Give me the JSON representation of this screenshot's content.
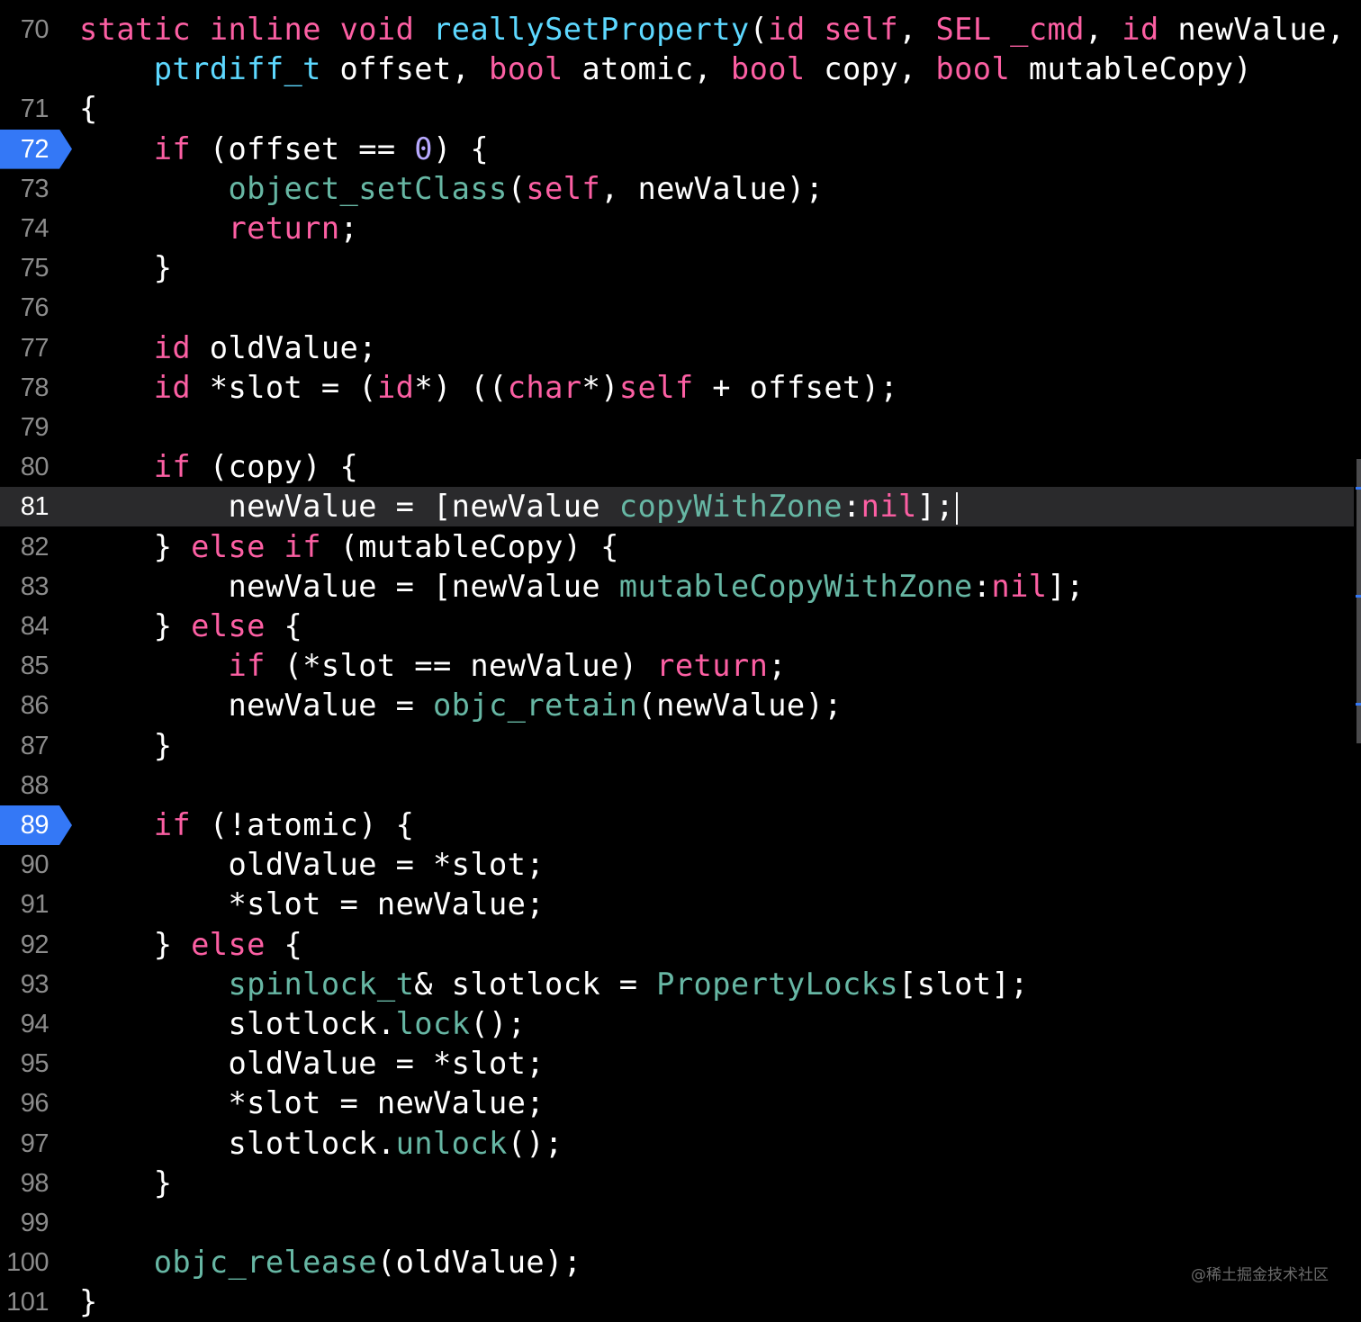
{
  "editor": {
    "cursor_line": "81",
    "breakpoint_lines": [
      "72",
      "89"
    ],
    "lines": [
      {
        "num": "70",
        "tokens": [
          {
            "t": "static",
            "c": "kw"
          },
          {
            "t": " ",
            "c": "plain"
          },
          {
            "t": "inline",
            "c": "kw"
          },
          {
            "t": " ",
            "c": "plain"
          },
          {
            "t": "void",
            "c": "kw"
          },
          {
            "t": " ",
            "c": "plain"
          },
          {
            "t": "reallySetProperty",
            "c": "sys"
          },
          {
            "t": "(",
            "c": "plain"
          },
          {
            "t": "id",
            "c": "kw"
          },
          {
            "t": " ",
            "c": "plain"
          },
          {
            "t": "self",
            "c": "kw"
          },
          {
            "t": ", ",
            "c": "plain"
          },
          {
            "t": "SEL",
            "c": "kw"
          },
          {
            "t": " ",
            "c": "plain"
          },
          {
            "t": "_cmd",
            "c": "kw"
          },
          {
            "t": ", ",
            "c": "plain"
          },
          {
            "t": "id",
            "c": "kw"
          },
          {
            "t": " newValue,",
            "c": "plain"
          }
        ]
      },
      {
        "num": "",
        "tokens": [
          {
            "t": "    ",
            "c": "plain"
          },
          {
            "t": "ptrdiff_t",
            "c": "sys"
          },
          {
            "t": " offset, ",
            "c": "plain"
          },
          {
            "t": "bool",
            "c": "kw"
          },
          {
            "t": " atomic, ",
            "c": "plain"
          },
          {
            "t": "bool",
            "c": "kw"
          },
          {
            "t": " copy, ",
            "c": "plain"
          },
          {
            "t": "bool",
            "c": "kw"
          },
          {
            "t": " mutableCopy)",
            "c": "plain"
          }
        ]
      },
      {
        "num": "71",
        "tokens": [
          {
            "t": "{",
            "c": "plain"
          }
        ]
      },
      {
        "num": "72",
        "tokens": [
          {
            "t": "    ",
            "c": "plain"
          },
          {
            "t": "if",
            "c": "kw"
          },
          {
            "t": " (offset == ",
            "c": "plain"
          },
          {
            "t": "0",
            "c": "num"
          },
          {
            "t": ") {",
            "c": "plain"
          }
        ]
      },
      {
        "num": "73",
        "tokens": [
          {
            "t": "        ",
            "c": "plain"
          },
          {
            "t": "object_setClass",
            "c": "fn"
          },
          {
            "t": "(",
            "c": "plain"
          },
          {
            "t": "self",
            "c": "kw"
          },
          {
            "t": ", newValue);",
            "c": "plain"
          }
        ]
      },
      {
        "num": "74",
        "tokens": [
          {
            "t": "        ",
            "c": "plain"
          },
          {
            "t": "return",
            "c": "kw"
          },
          {
            "t": ";",
            "c": "plain"
          }
        ]
      },
      {
        "num": "75",
        "tokens": [
          {
            "t": "    }",
            "c": "plain"
          }
        ]
      },
      {
        "num": "76",
        "tokens": []
      },
      {
        "num": "77",
        "tokens": [
          {
            "t": "    ",
            "c": "plain"
          },
          {
            "t": "id",
            "c": "kw"
          },
          {
            "t": " oldValue;",
            "c": "plain"
          }
        ]
      },
      {
        "num": "78",
        "tokens": [
          {
            "t": "    ",
            "c": "plain"
          },
          {
            "t": "id",
            "c": "kw"
          },
          {
            "t": " *slot = (",
            "c": "plain"
          },
          {
            "t": "id",
            "c": "kw"
          },
          {
            "t": "*) ((",
            "c": "plain"
          },
          {
            "t": "char",
            "c": "kw"
          },
          {
            "t": "*)",
            "c": "plain"
          },
          {
            "t": "self",
            "c": "kw"
          },
          {
            "t": " + offset);",
            "c": "plain"
          }
        ]
      },
      {
        "num": "79",
        "tokens": []
      },
      {
        "num": "80",
        "tokens": [
          {
            "t": "    ",
            "c": "plain"
          },
          {
            "t": "if",
            "c": "kw"
          },
          {
            "t": " (copy) {",
            "c": "plain"
          }
        ]
      },
      {
        "num": "81",
        "tokens": [
          {
            "t": "        newValue = [newValue ",
            "c": "plain"
          },
          {
            "t": "copyWithZone",
            "c": "fn"
          },
          {
            "t": ":",
            "c": "plain"
          },
          {
            "t": "nil",
            "c": "kw"
          },
          {
            "t": "];",
            "c": "plain"
          }
        ]
      },
      {
        "num": "82",
        "tokens": [
          {
            "t": "    } ",
            "c": "plain"
          },
          {
            "t": "else",
            "c": "kw"
          },
          {
            "t": " ",
            "c": "plain"
          },
          {
            "t": "if",
            "c": "kw"
          },
          {
            "t": " (mutableCopy) {",
            "c": "plain"
          }
        ]
      },
      {
        "num": "83",
        "tokens": [
          {
            "t": "        newValue = [newValue ",
            "c": "plain"
          },
          {
            "t": "mutableCopyWithZone",
            "c": "fn"
          },
          {
            "t": ":",
            "c": "plain"
          },
          {
            "t": "nil",
            "c": "kw"
          },
          {
            "t": "];",
            "c": "plain"
          }
        ]
      },
      {
        "num": "84",
        "tokens": [
          {
            "t": "    } ",
            "c": "plain"
          },
          {
            "t": "else",
            "c": "kw"
          },
          {
            "t": " {",
            "c": "plain"
          }
        ]
      },
      {
        "num": "85",
        "tokens": [
          {
            "t": "        ",
            "c": "plain"
          },
          {
            "t": "if",
            "c": "kw"
          },
          {
            "t": " (*slot == newValue) ",
            "c": "plain"
          },
          {
            "t": "return",
            "c": "kw"
          },
          {
            "t": ";",
            "c": "plain"
          }
        ]
      },
      {
        "num": "86",
        "tokens": [
          {
            "t": "        newValue = ",
            "c": "plain"
          },
          {
            "t": "objc_retain",
            "c": "fn"
          },
          {
            "t": "(newValue);",
            "c": "plain"
          }
        ]
      },
      {
        "num": "87",
        "tokens": [
          {
            "t": "    }",
            "c": "plain"
          }
        ]
      },
      {
        "num": "88",
        "tokens": []
      },
      {
        "num": "89",
        "tokens": [
          {
            "t": "    ",
            "c": "plain"
          },
          {
            "t": "if",
            "c": "kw"
          },
          {
            "t": " (!atomic) {",
            "c": "plain"
          }
        ]
      },
      {
        "num": "90",
        "tokens": [
          {
            "t": "        oldValue = *slot;",
            "c": "plain"
          }
        ]
      },
      {
        "num": "91",
        "tokens": [
          {
            "t": "        *slot = newValue;",
            "c": "plain"
          }
        ]
      },
      {
        "num": "92",
        "tokens": [
          {
            "t": "    } ",
            "c": "plain"
          },
          {
            "t": "else",
            "c": "kw"
          },
          {
            "t": " {",
            "c": "plain"
          }
        ]
      },
      {
        "num": "93",
        "tokens": [
          {
            "t": "        ",
            "c": "plain"
          },
          {
            "t": "spinlock_t",
            "c": "fn"
          },
          {
            "t": "& slotlock = ",
            "c": "plain"
          },
          {
            "t": "PropertyLocks",
            "c": "fn"
          },
          {
            "t": "[slot];",
            "c": "plain"
          }
        ]
      },
      {
        "num": "94",
        "tokens": [
          {
            "t": "        slotlock.",
            "c": "plain"
          },
          {
            "t": "lock",
            "c": "fn"
          },
          {
            "t": "();",
            "c": "plain"
          }
        ]
      },
      {
        "num": "95",
        "tokens": [
          {
            "t": "        oldValue = *slot;",
            "c": "plain"
          }
        ]
      },
      {
        "num": "96",
        "tokens": [
          {
            "t": "        *slot = newValue;",
            "c": "plain"
          }
        ]
      },
      {
        "num": "97",
        "tokens": [
          {
            "t": "        slotlock.",
            "c": "plain"
          },
          {
            "t": "unlock",
            "c": "fn"
          },
          {
            "t": "();",
            "c": "plain"
          }
        ]
      },
      {
        "num": "98",
        "tokens": [
          {
            "t": "    }",
            "c": "plain"
          }
        ]
      },
      {
        "num": "99",
        "tokens": []
      },
      {
        "num": "100",
        "tokens": [
          {
            "t": "    ",
            "c": "plain"
          },
          {
            "t": "objc_release",
            "c": "fn"
          },
          {
            "t": "(oldValue);",
            "c": "plain"
          }
        ]
      },
      {
        "num": "101",
        "tokens": [
          {
            "t": "}",
            "c": "plain"
          }
        ]
      }
    ]
  },
  "watermark": "@稀土掘金技术社区",
  "colors": {
    "background": "#000000",
    "current_line": "#2a2a2c",
    "breakpoint": "#3478f6",
    "keyword": "#fc5fa3",
    "function": "#67b7a4",
    "type_decl": "#5dd8ff",
    "number": "#b8a9ff",
    "line_number": "#8c8c8c"
  }
}
